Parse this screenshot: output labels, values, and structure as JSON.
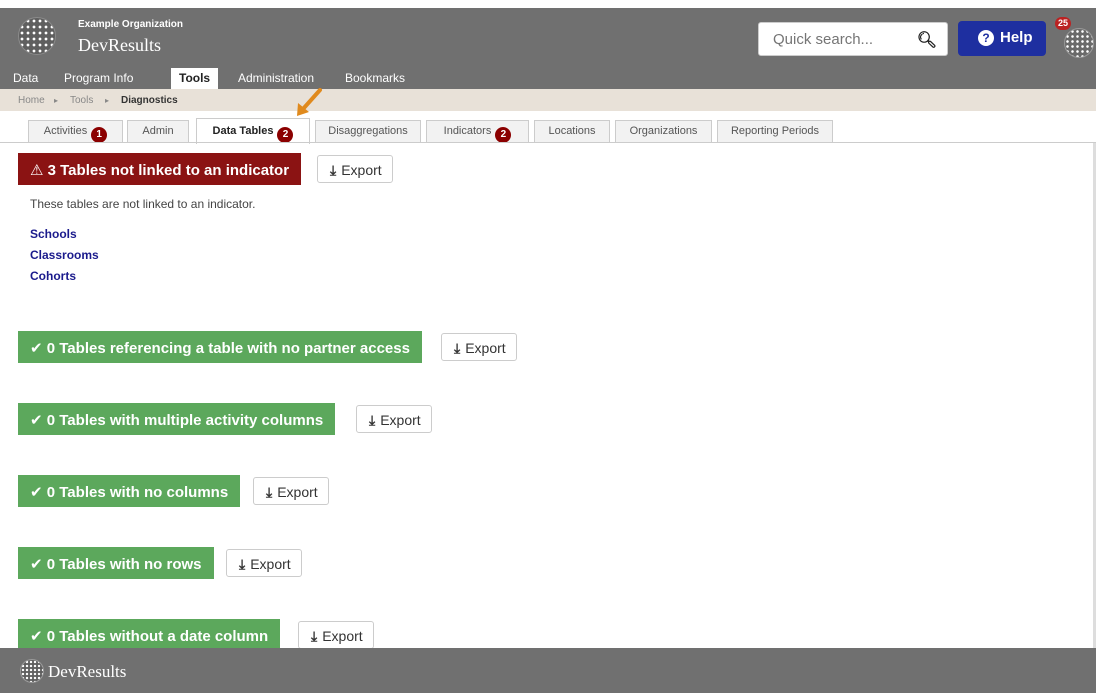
{
  "header": {
    "org_name": "Example Organization",
    "brand": "DevResults",
    "search_placeholder": "Quick search...",
    "help_label": "Help",
    "notification_count": "25"
  },
  "nav": [
    "Data",
    "Program Info",
    "Tools",
    "Administration",
    "Bookmarks"
  ],
  "breadcrumb": [
    "Home",
    "Tools",
    "Diagnostics"
  ],
  "tabs": [
    {
      "label": "Activities",
      "badge": "1"
    },
    {
      "label": "Admin",
      "badge": ""
    },
    {
      "label": "Data Tables",
      "badge": "2"
    },
    {
      "label": "Disaggregations",
      "badge": ""
    },
    {
      "label": "Indicators",
      "badge": "2"
    },
    {
      "label": "Locations",
      "badge": ""
    },
    {
      "label": "Organizations",
      "badge": ""
    },
    {
      "label": "Reporting Periods",
      "badge": ""
    }
  ],
  "export_label": "Export",
  "sections": [
    {
      "label": "3 Tables not linked to an indicator",
      "status": "warning"
    },
    {
      "label": "0 Tables referencing a table with no partner access",
      "status": "ok"
    },
    {
      "label": "0 Tables with multiple activity columns",
      "status": "ok"
    },
    {
      "label": "0 Tables with no columns",
      "status": "ok"
    },
    {
      "label": "0 Tables with no rows",
      "status": "ok"
    },
    {
      "label": "0 Tables without a date column",
      "status": "ok"
    }
  ],
  "description": "These tables are not linked to an indicator.",
  "tables": [
    "Schools",
    "Classrooms",
    "Cohorts"
  ],
  "footer": {
    "brand": "DevResults"
  },
  "colors": {
    "warning": "#8b1313",
    "ok": "#5ca85c",
    "header": "#707070",
    "help": "#1e2fa0"
  }
}
